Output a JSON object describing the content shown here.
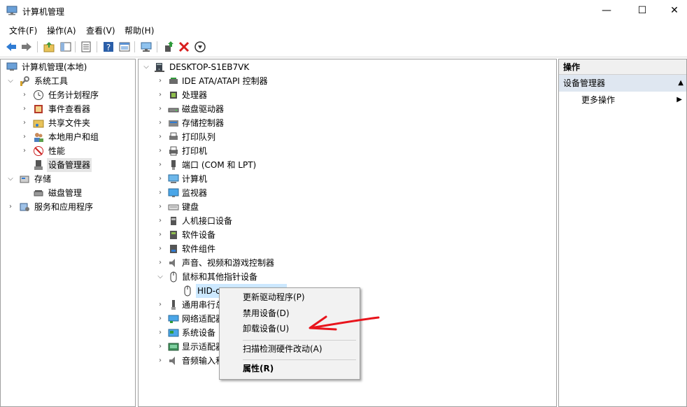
{
  "window": {
    "title": "计算机管理",
    "minimize": "—",
    "maximize": "☐",
    "close": "✕"
  },
  "menu": [
    "文件(F)",
    "操作(A)",
    "查看(V)",
    "帮助(H)"
  ],
  "toolbar": [
    "back-icon",
    "forward-icon",
    "up-folder-icon",
    "show-hide-tree-icon",
    "export-icon",
    "help-icon",
    "properties-icon",
    "monitor-icon",
    "update-driver-icon",
    "uninstall-icon",
    "disable-icon"
  ],
  "left_tree": [
    {
      "label": "计算机管理(本地)",
      "icon": "computer-management-icon",
      "arrow": "",
      "indent": 0
    },
    {
      "label": "系统工具",
      "icon": "tools-icon",
      "arrow": "v",
      "indent": 1
    },
    {
      "label": "任务计划程序",
      "icon": "clock-icon",
      "arrow": ">",
      "indent": 2
    },
    {
      "label": "事件查看器",
      "icon": "event-viewer-icon",
      "arrow": ">",
      "indent": 2
    },
    {
      "label": "共享文件夹",
      "icon": "shared-folder-icon",
      "arrow": ">",
      "indent": 2
    },
    {
      "label": "本地用户和组",
      "icon": "users-icon",
      "arrow": ">",
      "indent": 2
    },
    {
      "label": "性能",
      "icon": "performance-icon",
      "arrow": ">",
      "indent": 2
    },
    {
      "label": "设备管理器",
      "icon": "device-manager-icon",
      "arrow": "",
      "indent": 2,
      "selected": true
    },
    {
      "label": "存储",
      "icon": "storage-icon",
      "arrow": "v",
      "indent": 1
    },
    {
      "label": "磁盘管理",
      "icon": "disk-management-icon",
      "arrow": "",
      "indent": 2
    },
    {
      "label": "服务和应用程序",
      "icon": "services-icon",
      "arrow": ">",
      "indent": 1
    }
  ],
  "device_tree": {
    "root": "DESKTOP-S1EB7VK",
    "items": [
      {
        "label": "IDE ATA/ATAPI 控制器",
        "icon": "ide-controller-icon"
      },
      {
        "label": "处理器",
        "icon": "processor-icon"
      },
      {
        "label": "磁盘驱动器",
        "icon": "disk-drive-icon"
      },
      {
        "label": "存储控制器",
        "icon": "storage-controller-icon"
      },
      {
        "label": "打印队列",
        "icon": "print-queue-icon"
      },
      {
        "label": "打印机",
        "icon": "printer-icon"
      },
      {
        "label": "端口 (COM 和 LPT)",
        "icon": "port-icon"
      },
      {
        "label": "计算机",
        "icon": "computer-icon"
      },
      {
        "label": "监视器",
        "icon": "monitor-icon"
      },
      {
        "label": "键盘",
        "icon": "keyboard-icon"
      },
      {
        "label": "人机接口设备",
        "icon": "hid-icon"
      },
      {
        "label": "软件设备",
        "icon": "software-device-icon"
      },
      {
        "label": "软件组件",
        "icon": "software-component-icon"
      },
      {
        "label": "声音、视频和游戏控制器",
        "icon": "sound-icon"
      },
      {
        "label": "鼠标和其他指针设备",
        "icon": "mouse-icon",
        "expanded": true
      },
      {
        "label": "HID-c...",
        "icon": "mouse-icon",
        "child": true,
        "selected": true
      },
      {
        "label": "通用串行总",
        "icon": "usb-icon"
      },
      {
        "label": "网络适配器",
        "icon": "network-adapter-icon"
      },
      {
        "label": "系统设备",
        "icon": "system-device-icon"
      },
      {
        "label": "显示适配器",
        "icon": "display-adapter-icon"
      },
      {
        "label": "音频输入和",
        "icon": "audio-input-icon"
      }
    ]
  },
  "actions": {
    "header": "操作",
    "section": "设备管理器",
    "more": "更多操作"
  },
  "context_menu": {
    "items": [
      "更新驱动程序(P)",
      "禁用设备(D)",
      "卸载设备(U)",
      "扫描检测硬件改动(A)",
      "属性(R)"
    ]
  },
  "colors": {
    "annotation_arrow": "#e8141c",
    "selection": "#cce8ff",
    "action_section": "#dfe7f1"
  }
}
